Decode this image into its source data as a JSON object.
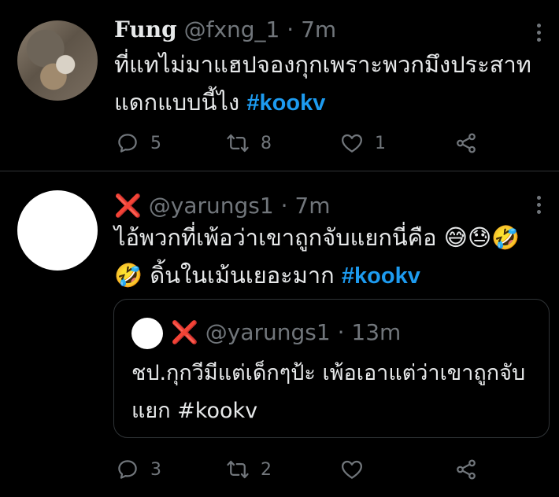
{
  "tweets": [
    {
      "display_name": "Fung",
      "handle": "@fxng_1",
      "separator": "·",
      "time": "7m",
      "text": "ที่แทไม่มาแฮปจองกุกเพราะพวกมึงประสาทแดกแบบนี้ไง ",
      "hashtag": "#kookv",
      "replies": "5",
      "retweets": "8",
      "likes": "1"
    },
    {
      "name_emoji": "❌",
      "handle": "@yarungs1",
      "separator": "·",
      "time": "7m",
      "text": "ไอ้พวกที่เพ้อว่าเขาถูกจับแยกนี่คือ 😅😓🤣🤣 ดิ้นในเม้นเยอะมาก ",
      "hashtag": "#kookv",
      "replies": "3",
      "retweets": "2",
      "likes": "",
      "quoted": {
        "name_emoji": "❌",
        "handle": "@yarungs1",
        "separator": "·",
        "time": "13m",
        "text": "ชป.กุกวีมีแต่เด็กๆป้ะ เพ้อเอาแต่ว่าเขาถูกจับแยก  ",
        "hashtag": "#kookv"
      }
    }
  ],
  "icons": {
    "reply": "reply-icon",
    "retweet": "retweet-icon",
    "like": "heart-icon",
    "share": "share-icon",
    "more": "more-icon"
  },
  "colors": {
    "background": "#000000",
    "text": "#e7e9ea",
    "muted": "#71767b",
    "hashtag": "#1d9bf0",
    "divider": "#2f3336"
  }
}
